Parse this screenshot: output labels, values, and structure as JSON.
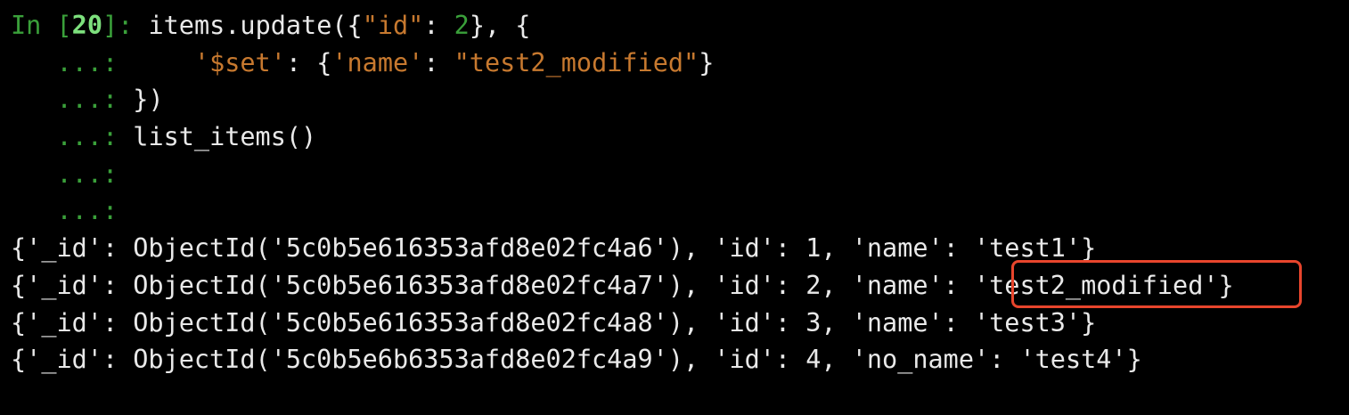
{
  "colors": {
    "background": "#000000",
    "prompt": "#3aa03a",
    "string": "#c7792f",
    "text": "#e9e9e9",
    "highlight_border": "#e8452c"
  },
  "input": {
    "prompt_in": "In ",
    "prompt_lbracket": "[",
    "prompt_number": "20",
    "prompt_rbracket": "]: ",
    "continuation": "   ...: ",
    "line1": {
      "a": "items.update({",
      "b": "\"id\"",
      "c": ": ",
      "d": "2",
      "e": "}, {"
    },
    "line2": {
      "indent": "    ",
      "a": "'$set'",
      "b": ": {",
      "c": "'name'",
      "d": ": ",
      "e": "\"test2_modified\"",
      "f": "}"
    },
    "line3": "})",
    "line4": "list_items()"
  },
  "output": {
    "rows": [
      {
        "pre": "{'_id': ObjectId('5c0b5e616353afd8e02fc4a6'), 'id': 1, 'name': ",
        "val": "'test1'",
        "post": "}"
      },
      {
        "pre": "{'_id': ObjectId('5c0b5e616353afd8e02fc4a7'), 'id': 2, 'name': ",
        "val": "'test2_modified'",
        "post": "}"
      },
      {
        "pre": "{'_id': ObjectId('5c0b5e616353afd8e02fc4a8'), 'id': 3, 'name': ",
        "val": "'test3'",
        "post": "}"
      },
      {
        "pre": "{'_id': ObjectId('5c0b5e6b6353afd8e02fc4a9'), 'id': 4, 'no_name': ",
        "val": "'test4'",
        "post": "}"
      }
    ]
  }
}
